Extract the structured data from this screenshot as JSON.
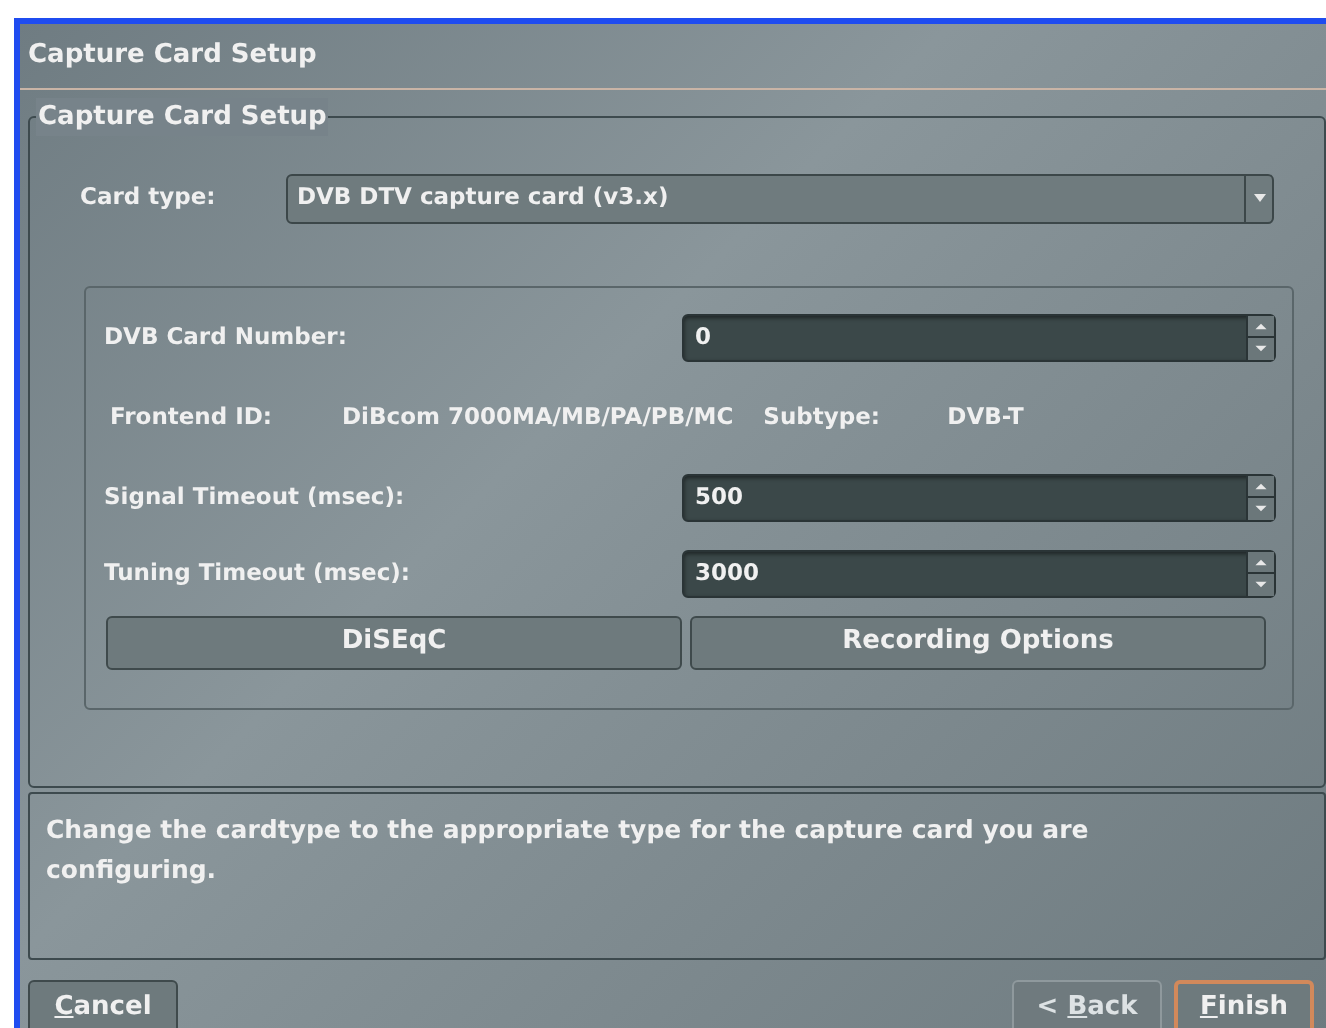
{
  "window": {
    "title": "Capture Card Setup"
  },
  "group": {
    "title": "Capture Card Setup"
  },
  "card_type": {
    "label": "Card type:",
    "value": "DVB DTV capture card (v3.x)"
  },
  "fields": [
    {
      "kind": "spin",
      "label": "DVB Card Number:",
      "value": "0"
    },
    {
      "kind": "info",
      "label": "Frontend ID:",
      "value": "DiBcom 7000MA/MB/PA/PB/MC",
      "sublabel": "Subtype:",
      "subvalue": "DVB-T"
    },
    {
      "kind": "spin",
      "label": "Signal Timeout (msec):",
      "value": "500"
    },
    {
      "kind": "spin",
      "label": "Tuning Timeout (msec):",
      "value": "3000"
    }
  ],
  "panel_buttons": [
    "DiSEqC",
    "Recording Options"
  ],
  "help_text": "Change the cardtype to the appropriate type for the capture card you are configuring.",
  "buttons": [
    {
      "mnemonic": "C",
      "label_rest": "ancel",
      "disabled": false,
      "default": false
    },
    {
      "label_start": "< ",
      "mnemonic": "B",
      "label_rest": "ack",
      "disabled": true,
      "default": false
    },
    {
      "mnemonic": "F",
      "label_rest": "inish",
      "disabled": false,
      "default": true
    }
  ]
}
